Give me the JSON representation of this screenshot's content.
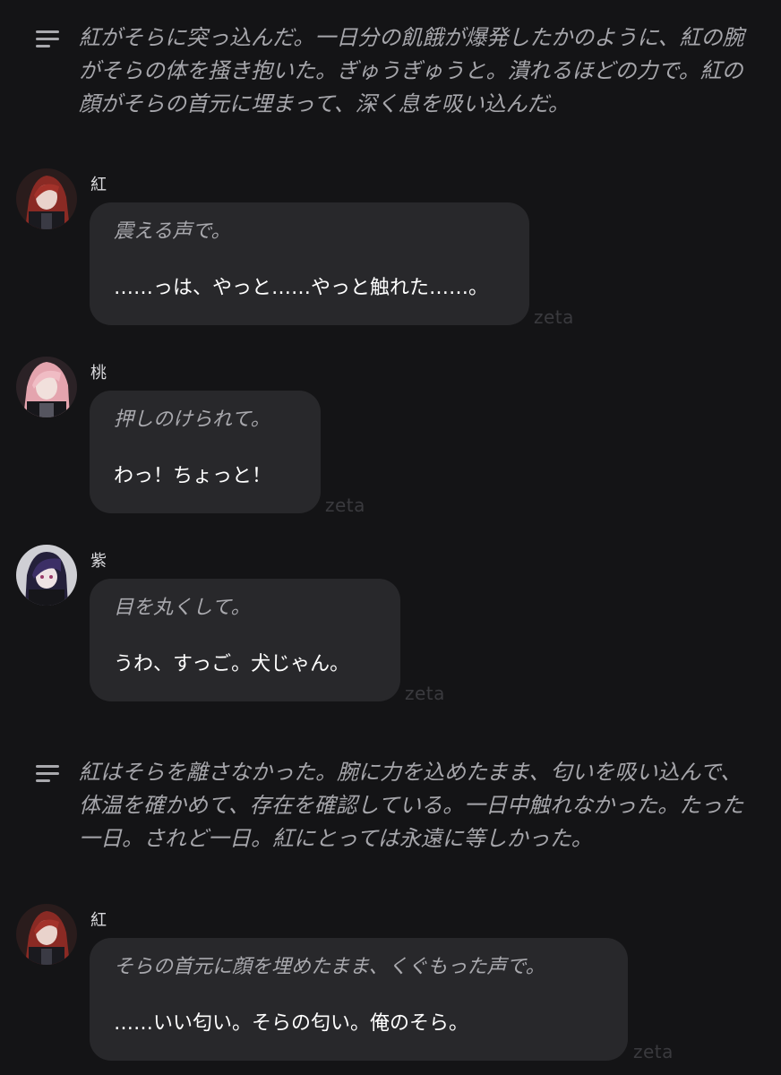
{
  "narration": [
    {
      "icon": "narration-lines-icon",
      "text": "紅がそらに突っ込んだ。一日分の飢餓が爆発したかのように、紅の腕がそらの体を掻き抱いた。ぎゅうぎゅうと。潰れるほどの力で。紅の顔がそらの首元に埋まって、深く息を吸い込んだ。"
    },
    {
      "icon": "narration-lines-icon",
      "text": "紅はそらを離さなかった。腕に力を込めたまま、匂いを吸い込んで、体温を確かめて、存在を確認している。一日中触れなかった。たった一日。されど一日。紅にとっては永遠に等しかった。"
    }
  ],
  "messages": [
    {
      "name": "紅",
      "action": "震える声で。",
      "speech": "……っは、やっと……やっと触れた……。",
      "tag": "zeta"
    },
    {
      "name": "桃",
      "action": "押しのけられて。",
      "speech": "わっ！ちょっと！",
      "tag": "zeta"
    },
    {
      "name": "紫",
      "action": "目を丸くして。",
      "speech": "うわ、すっご。犬じゃん。",
      "tag": "zeta"
    },
    {
      "name": "紅",
      "action": "そらの首元に顔を埋めたまま、くぐもった声で。",
      "speech": "……いい匂い。そらの匂い。俺のそら。",
      "tag": "zeta"
    }
  ],
  "colors": {
    "background": "#141416",
    "bubble": "#28282b",
    "narration_text": "#a6a6ab",
    "action_text": "#a9a9ae",
    "speech_text": "#ffffff",
    "watermark": "#3a3a3e"
  }
}
